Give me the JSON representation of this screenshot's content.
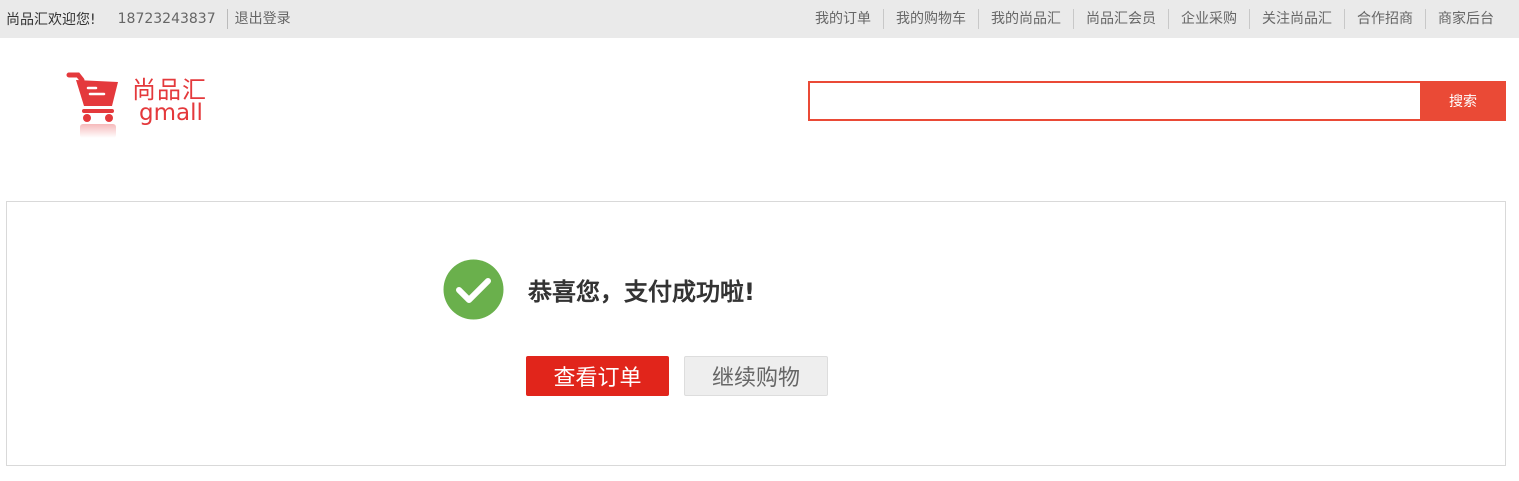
{
  "topbar": {
    "welcome": "尚品汇欢迎您!",
    "phone": "18723243837",
    "logout": "退出登录",
    "nav": [
      "我的订单",
      "我的购物车",
      "我的尚品汇",
      "尚品汇会员",
      "企业采购",
      "关注尚品汇",
      "合作招商",
      "商家后台"
    ]
  },
  "header": {
    "brand_cn": "尚品汇",
    "brand_en": "gmall",
    "search_placeholder": "",
    "search_button": "搜索"
  },
  "success": {
    "title": "恭喜您，支付成功啦!",
    "view_order": "查看订单",
    "continue_shopping": "继续购物"
  },
  "colors": {
    "accent": "#e1251b",
    "search": "#ea4a36",
    "success_green": "#6ab04c"
  },
  "icons": {
    "logo": "shopping-cart-icon",
    "success": "check-circle-icon"
  }
}
